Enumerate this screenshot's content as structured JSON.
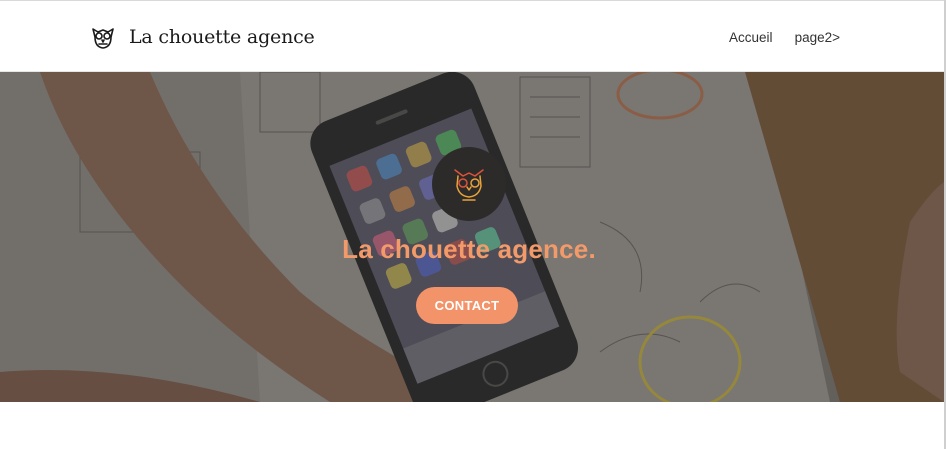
{
  "header": {
    "brand_name": "La chouette agence",
    "nav": [
      {
        "label": "Accueil"
      },
      {
        "label": "page2>"
      }
    ]
  },
  "hero": {
    "title": "La chouette agence.",
    "cta_label": "CONTACT",
    "background_description_icon": "phone-on-desk-sketches",
    "badge_icon": "owl-icon"
  },
  "colors": {
    "accent": "#f2936a",
    "title": "#f29a6a",
    "badge_bg": "#2d2b2a",
    "owl_stroke_1": "#e8a33a",
    "owl_stroke_2": "#e0523a"
  }
}
